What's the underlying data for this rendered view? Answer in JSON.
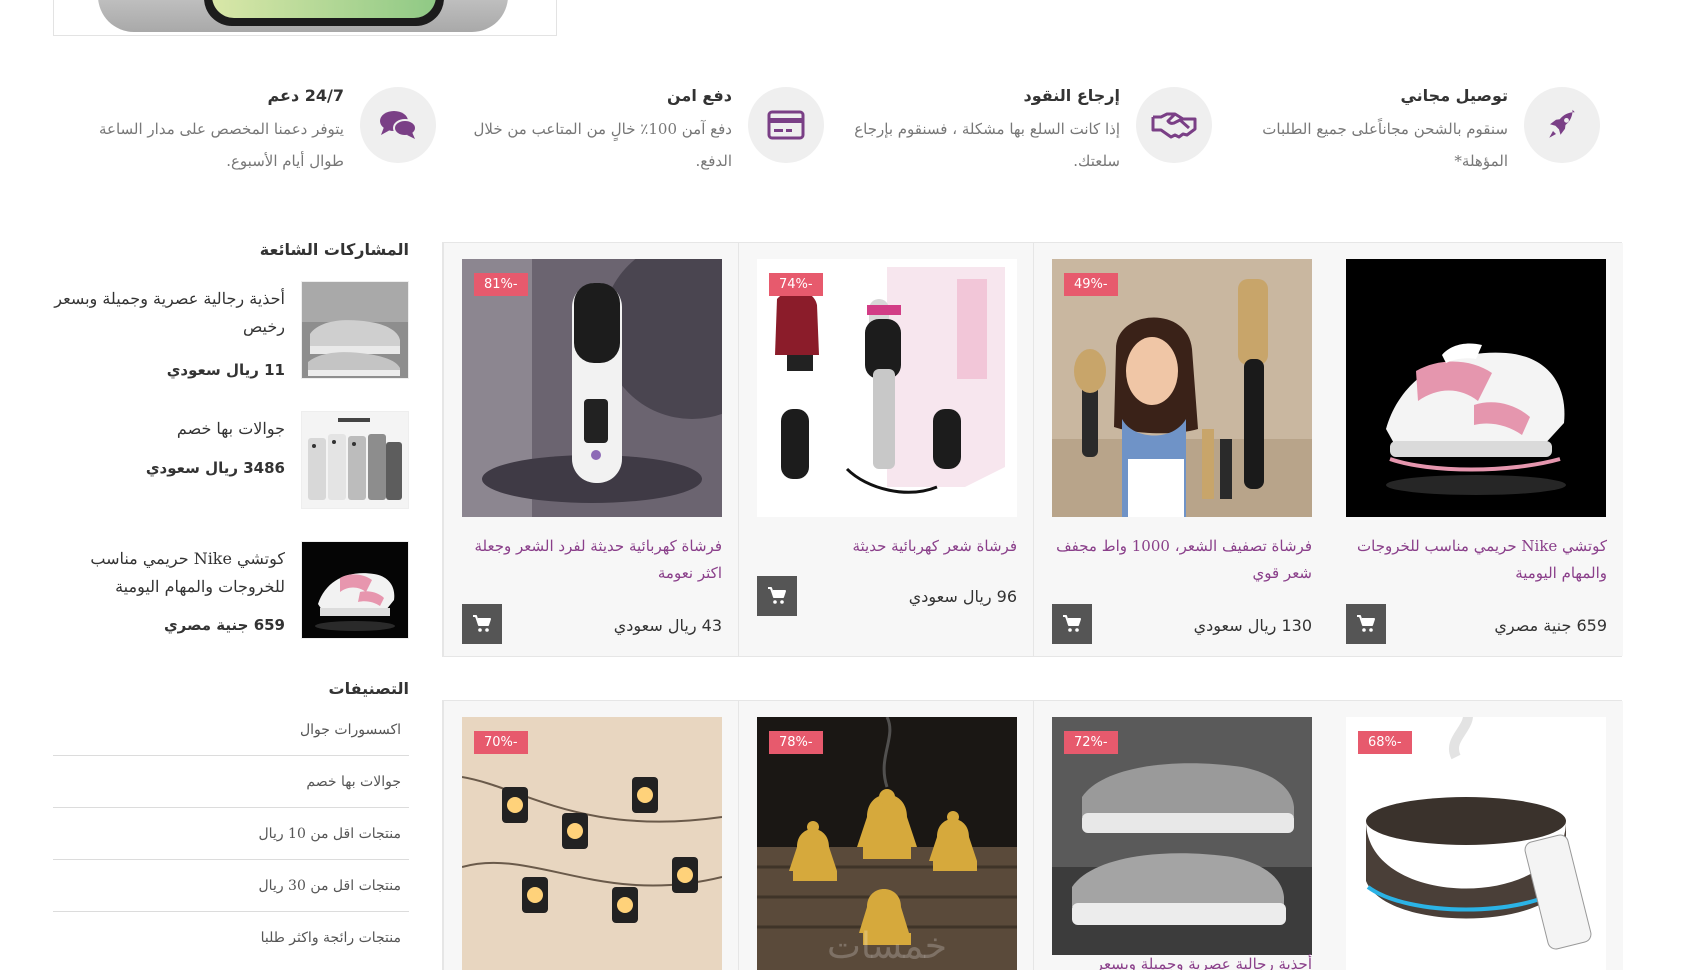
{
  "features": [
    {
      "title": "توصيل مجاني",
      "desc": "سنقوم بالشحن مجاناًعلى جميع الطلبات المؤهلة*",
      "icon": "rocket-icon"
    },
    {
      "title": "إرجاع النقود",
      "desc": "إذا كانت السلع بها مشكلة ، فسنقوم بإرجاع سلعتك.",
      "icon": "handshake-icon"
    },
    {
      "title": "دفع امن",
      "desc": "دفع آمن 100٪ خالٍ من المتاعب من خلال الدفع.",
      "icon": "credit-card-icon"
    },
    {
      "title": "24/7 دعم",
      "desc": "يتوفر دعمنا المخصص على مدار الساعة طوال أيام الأسبوع.",
      "icon": "chat-icon"
    }
  ],
  "sidebar": {
    "popular_heading": "المشاركات الشائعة",
    "posts": [
      {
        "title": "أحذية رجالية عصرية وجميلة وبسعر رخيص",
        "price": "11 ريال سعودي"
      },
      {
        "title": "جوالات بها خصم",
        "price": "3486 ريال سعودي"
      },
      {
        "title": "كوتشي Nike حريمي مناسب للخروجات والمهام اليومية",
        "price": "659 جنية مصري"
      }
    ],
    "categories_heading": "التصنيفات",
    "categories": [
      "اكسسورات جوال",
      "جوالات بها خصم",
      "منتجات اقل من 10 ريال",
      "منتجات اقل من 30 ريال",
      "منتجات رائجة واكثر طلبا"
    ]
  },
  "products_row1": [
    {
      "title": "كوتشي Nike حريمي مناسب للخروجات والمهام اليومية",
      "price": "659 جنية مصري",
      "badge": ""
    },
    {
      "title": "فرشاة تصفيف الشعر، 1000 واط مجفف شعر قوي",
      "price": "130 ريال سعودي",
      "badge": "49%-"
    },
    {
      "title": "فرشاة شعر كهربائية حديثة",
      "price": "96 ريال سعودي",
      "badge": "74%-"
    },
    {
      "title": "فرشاة كهربائية حديثة لفرد الشعر وجعلة اكثر نعومة",
      "price": "43 ريال سعودي",
      "badge": "81%-"
    }
  ],
  "products_row2": [
    {
      "title": "",
      "badge": "68%-"
    },
    {
      "title": "أحذية رجالية عصرية وجميلة وبسعر",
      "badge": "72%-"
    },
    {
      "title": "",
      "badge": "78%-"
    },
    {
      "title": "",
      "badge": "70%-"
    }
  ],
  "watermark": "خمسات",
  "colors": {
    "accent": "#8a3f8a",
    "badge": "#e75a6d",
    "cart": "#555555",
    "icon": "#7a3f86"
  }
}
